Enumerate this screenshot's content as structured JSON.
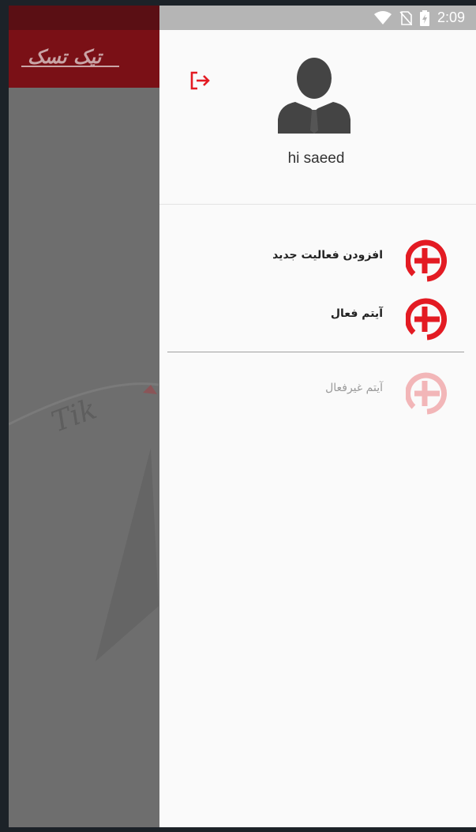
{
  "status_bar": {
    "time": "2:09"
  },
  "app": {
    "logo_text": "تیک تسک",
    "watermark_text": "Tik"
  },
  "drawer": {
    "greeting": "hi saeed",
    "menu_items": [
      {
        "label": "افزودن فعالیت جدید",
        "enabled": true
      },
      {
        "label": "آیتم فعال",
        "enabled": true
      },
      {
        "label": "آیتم غیرفعال",
        "enabled": false
      }
    ]
  },
  "colors": {
    "accent": "#e31b23",
    "appbar": "#7a1016",
    "drawer_bg": "#fafafa"
  },
  "icons": [
    "wifi-icon",
    "no-sim-icon",
    "battery-icon",
    "logout-icon",
    "user-avatar-icon",
    "add-circle-icon"
  ]
}
